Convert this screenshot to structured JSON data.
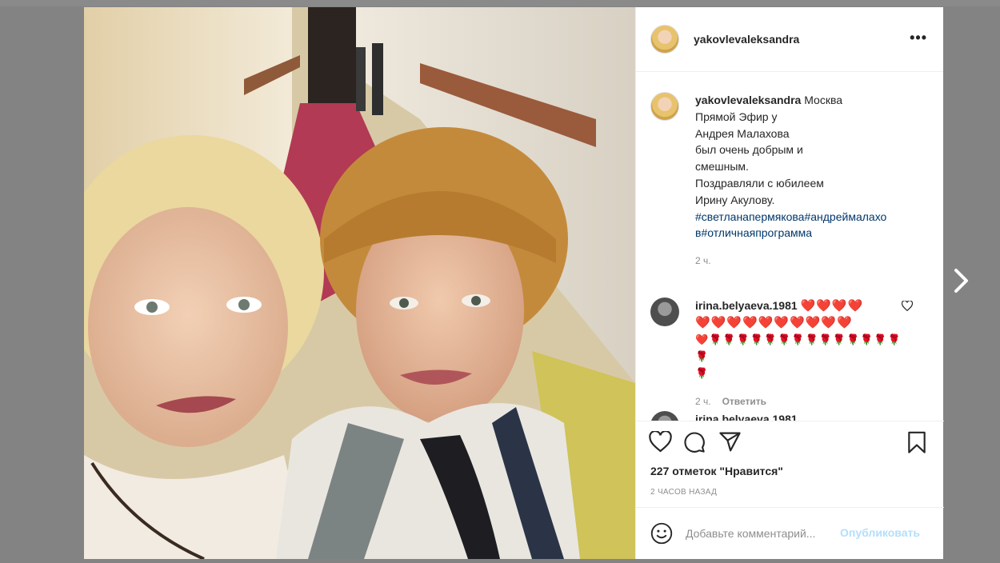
{
  "post": {
    "username": "yakovlevaleksandra",
    "more_label": "•••",
    "caption": {
      "username": "yakovlevaleksandra",
      "lines": [
        "Москва",
        "Прямой Эфир у",
        "Андрея Малахова",
        "был очень добрым и",
        "смешным.",
        "Поздравляли с юбилеем",
        "Ирину Акулову."
      ],
      "hashtags_line1": "#светланапермякова#андреймалахо",
      "hashtags_line2": "в#отличнаяпрограмма",
      "time": "2 ч."
    },
    "comments": [
      {
        "username": "irina.belyaeva.1981",
        "hearts_row1": "❤️❤️❤️❤️",
        "hearts_row2": "❤️❤️❤️❤️❤️❤️❤️❤️❤️❤️",
        "hearts_row3": "❤️🌹🌹🌹🌹🌹🌹🌹🌹🌹🌹🌹🌹🌹🌹🌹",
        "hearts_row4": "🌹",
        "time": "2 ч.",
        "reply_label": "Ответить"
      },
      {
        "username": "irina.belyaeva.1981"
      }
    ],
    "likes_text": "227 отметок \"Нравится\"",
    "timestamp": "2 ЧАСОВ НАЗАД",
    "comment_placeholder": "Добавьте комментарий...",
    "publish_label": "Опубликовать",
    "icons": [
      "heart-icon",
      "comment-icon",
      "share-icon",
      "bookmark-icon",
      "emoji-icon",
      "chevron-right-icon",
      "more-icon"
    ],
    "colors": {
      "link": "#00376b",
      "publish_disabled": "#b2dffc",
      "muted": "#8e8e8e",
      "overlay": "#838383"
    }
  }
}
